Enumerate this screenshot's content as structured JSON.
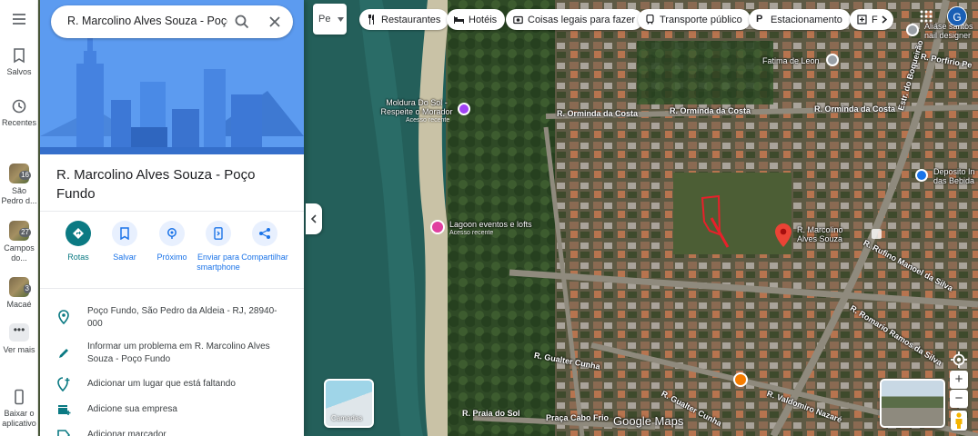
{
  "rail": {
    "saved": "Salvos",
    "recent": "Recentes",
    "recent_items": [
      {
        "label": "São Pedro d...",
        "badge": "16"
      },
      {
        "label": "Campos do...",
        "badge": "27"
      },
      {
        "label": "Macaé",
        "badge": "3"
      }
    ],
    "more": "Ver mais",
    "download": "Baixar o aplicativo"
  },
  "search": {
    "value": "R. Marcolino Alves Souza - Poço Fundo"
  },
  "place": {
    "title": "R. Marcolino Alves Souza - Poço Fundo",
    "actions": [
      {
        "label": "Rotas",
        "icon": "directions-icon"
      },
      {
        "label": "Salvar",
        "icon": "bookmark-icon"
      },
      {
        "label": "Próximo",
        "icon": "nearby-icon"
      },
      {
        "label": "Enviar para smartphone",
        "icon": "phone-icon"
      },
      {
        "label": "Compartilhar",
        "icon": "share-icon"
      }
    ],
    "info": [
      {
        "icon": "location-pin-icon",
        "text": "Poço Fundo, São Pedro da Aldeia - RJ, 28940-000"
      },
      {
        "icon": "edit-pencil-icon",
        "text": "Informar um problema em R. Marcolino Alves Souza - Poço Fundo"
      },
      {
        "icon": "add-place-icon",
        "text": "Adicionar um lugar que está faltando"
      },
      {
        "icon": "add-business-icon",
        "text": "Adicione sua empresa"
      },
      {
        "icon": "label-icon",
        "text": "Adicionar marcador"
      }
    ]
  },
  "chips": [
    {
      "label": "Restaurantes",
      "icon": "fork-knife-icon"
    },
    {
      "label": "Hotéis",
      "icon": "bed-icon"
    },
    {
      "label": "Coisas legais para fazer",
      "icon": "camera-icon"
    },
    {
      "label": "Transporte público",
      "icon": "train-icon"
    },
    {
      "label": "Estacionamento",
      "icon": "parking-icon"
    },
    {
      "label": "F",
      "icon": "pharmacy-icon"
    }
  ],
  "pegman_button": "Pe",
  "avatar_letter": "G",
  "map": {
    "streets": [
      "R. Orminda da Costa",
      "R. Orminda da Costa",
      "R. Orminda da Costa",
      "Estr. do Boqueirão",
      "R. Rufino Manoel da Silva",
      "R. Romario Ramos da Silva",
      "R. Gualter Cunha",
      "R. Gualter Cunha",
      "R. Praia do Sol",
      "Praça Cabo Frio",
      "R. Valdomiro Nazaré",
      "R. Porfirio Pe"
    ],
    "pois": [
      {
        "name": "Moldura Do Sol - Respeite o Morador",
        "sub": "Acesso recente"
      },
      {
        "name": "Lagoon eventos e lofts",
        "sub": "Acesso recente"
      },
      {
        "name": "Fatima de Leon",
        "sub": ""
      },
      {
        "name": "Aliase santos nail designer",
        "sub": ""
      },
      {
        "name": "Deposito In das Bebida",
        "sub": ""
      }
    ],
    "pin_label": "R. Marcolino Alves Souza",
    "layers_label": "Camadas",
    "brand": "Google Maps",
    "colors": {
      "accent": "#1a73e8",
      "pin": "#ea4335",
      "teal": "#0b7a83",
      "water": "#1f5f5a"
    }
  }
}
